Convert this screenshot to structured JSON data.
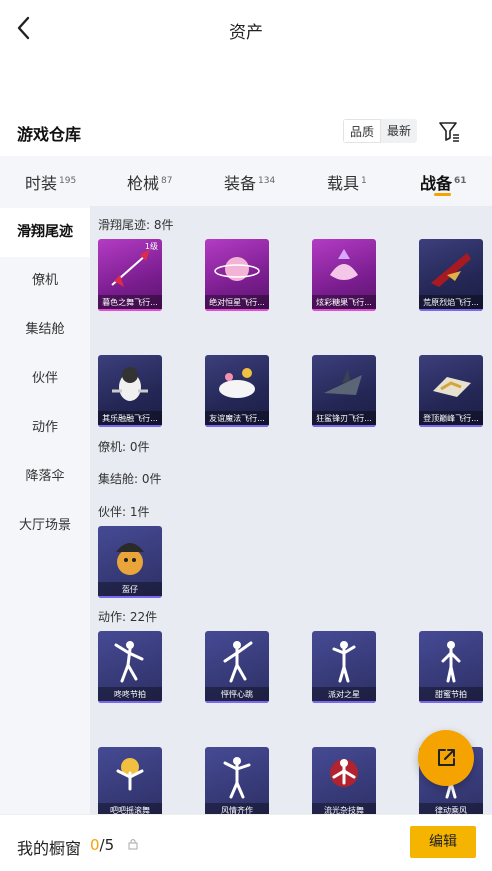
{
  "header": {
    "title": "资产"
  },
  "warehouse": {
    "title": "游戏仓库",
    "sort_options": [
      "品质",
      "最新"
    ]
  },
  "tabs": [
    {
      "label": "时装",
      "count": "195"
    },
    {
      "label": "枪械",
      "count": "87"
    },
    {
      "label": "装备",
      "count": "134"
    },
    {
      "label": "载具",
      "count": "1"
    },
    {
      "label": "战备",
      "count": "61",
      "active": true
    }
  ],
  "sidebar": [
    "滑翔尾迹",
    "僚机",
    "集结舱",
    "伙伴",
    "动作",
    "降落伞",
    "大厅场景"
  ],
  "sections": {
    "trail": "滑翔尾迹: 8件",
    "wingman": "僚机: 0件",
    "pod": "集结舱: 0件",
    "partner": "伙伴: 1件",
    "emote": "动作: 22件"
  },
  "trail_items": [
    {
      "name": "暮色之舞飞行...",
      "level": "1级",
      "rarity": "purple",
      "icon": "spear-trail-icon"
    },
    {
      "name": "绝对恒星飞行...",
      "rarity": "purple",
      "icon": "planet-trail-icon"
    },
    {
      "name": "炫彩糖果飞行...",
      "rarity": "purple",
      "icon": "candy-trail-icon"
    },
    {
      "name": "荒原烈焰飞行...",
      "rarity": "dark",
      "icon": "flame-craft-icon"
    },
    {
      "name": "其乐融融飞行...",
      "rarity": "dark",
      "icon": "penguin-craft-icon"
    },
    {
      "name": "友谊魔法飞行...",
      "rarity": "dark",
      "icon": "cloud-magic-icon"
    },
    {
      "name": "狂鲨锋刃飞行...",
      "rarity": "dark",
      "icon": "shark-craft-icon"
    },
    {
      "name": "登顶巅峰飞行...",
      "rarity": "dark",
      "icon": "gold-craft-icon"
    }
  ],
  "partner_items": [
    {
      "name": "盔仔",
      "icon": "helmet-chick-icon"
    }
  ],
  "emote_items": [
    {
      "name": "咚咚节拍",
      "icon": "dance-pose-icon"
    },
    {
      "name": "怦怦心跳",
      "icon": "dance-pose-icon"
    },
    {
      "name": "派对之星",
      "icon": "dance-pose-icon"
    },
    {
      "name": "甜蜜节拍",
      "icon": "dance-pose-icon"
    },
    {
      "name": "吧吧摇滚舞",
      "icon": "dance-pose-icon"
    },
    {
      "name": "风情齐作",
      "icon": "dance-pose-icon"
    },
    {
      "name": "流光杂技舞",
      "icon": "dance-pose-icon"
    },
    {
      "name": "律动乘风",
      "icon": "dance-pose-icon"
    }
  ],
  "bottom": {
    "label": "我的橱窗",
    "current": "0",
    "total": "/5",
    "button": "编辑"
  },
  "colors": {
    "accent": "#f5a300",
    "purple_card": "#9b2fb0",
    "dark_card": "#2a2d5e"
  }
}
